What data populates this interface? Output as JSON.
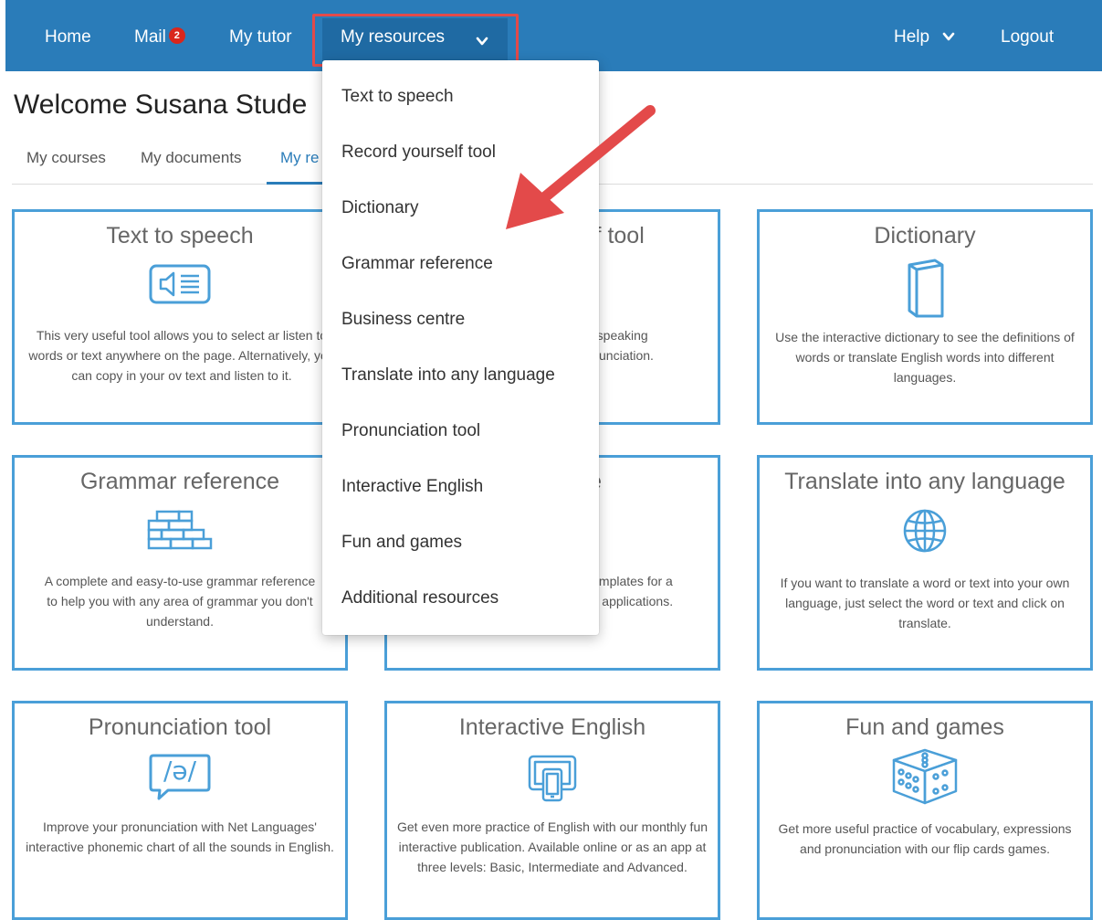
{
  "nav": {
    "home": "Home",
    "mail": "Mail",
    "mail_badge": "2",
    "tutor": "My tutor",
    "resources": "My resources",
    "help": "Help",
    "logout": "Logout"
  },
  "welcome": "Welcome Susana Stude",
  "tabs": {
    "courses": "My courses",
    "documents": "My documents",
    "resources": "My re"
  },
  "dropdown": [
    "Text to speech",
    "Record yourself tool",
    "Dictionary",
    "Grammar reference",
    "Business centre",
    "Translate into any language",
    "Pronunciation tool",
    "Interactive English",
    "Fun and games",
    "Additional resources"
  ],
  "cards": [
    {
      "title": "Text to speech",
      "desc": "This very useful tool allows you to select ar listen to words or text anywhere on the page. Alternatively, you can copy in your ov text and listen to it.",
      "icon": "speaker-text-icon"
    },
    {
      "title": "lf tool",
      "desc": "self speaking pronunciation.",
      "icon": "microphone-icon"
    },
    {
      "title": "Dictionary",
      "desc": "Use the interactive dictionary to see the definitions of words or translate English words into different languages.",
      "icon": "book-icon"
    },
    {
      "title": "Grammar reference",
      "desc": "A complete and easy-to-use grammar reference to help you with any area of grammar you don't understand.",
      "icon": "bricks-icon"
    },
    {
      "title": "ntre",
      "desc": "ge for different mplates for a reports and job applications.",
      "icon": "briefcase-icon"
    },
    {
      "title": "Translate into any language",
      "desc": "If you want to translate a word or text into your own language, just select the word or text and click on translate.",
      "icon": "globe-icon"
    },
    {
      "title": "Pronunciation tool",
      "desc": "Improve your pronunciation with Net Languages' interactive phonemic chart of all the sounds in English.",
      "icon": "phoneme-bubble-icon",
      "icon_text": "/ə/"
    },
    {
      "title": "Interactive English",
      "desc": "Get even more practice of English with our monthly fun interactive publication. Available online or as an app at three levels: Basic, Intermediate and Advanced.",
      "icon": "tablet-phone-icon"
    },
    {
      "title": "Fun and games",
      "desc": "Get more useful practice of vocabulary, expressions and pronunciation with our flip cards games.",
      "icon": "dice-icon"
    }
  ],
  "colors": {
    "nav_bg": "#2a7cb9",
    "card_border": "#4a9fd8",
    "highlight": "#e34a4a",
    "badge": "#d9261c"
  }
}
